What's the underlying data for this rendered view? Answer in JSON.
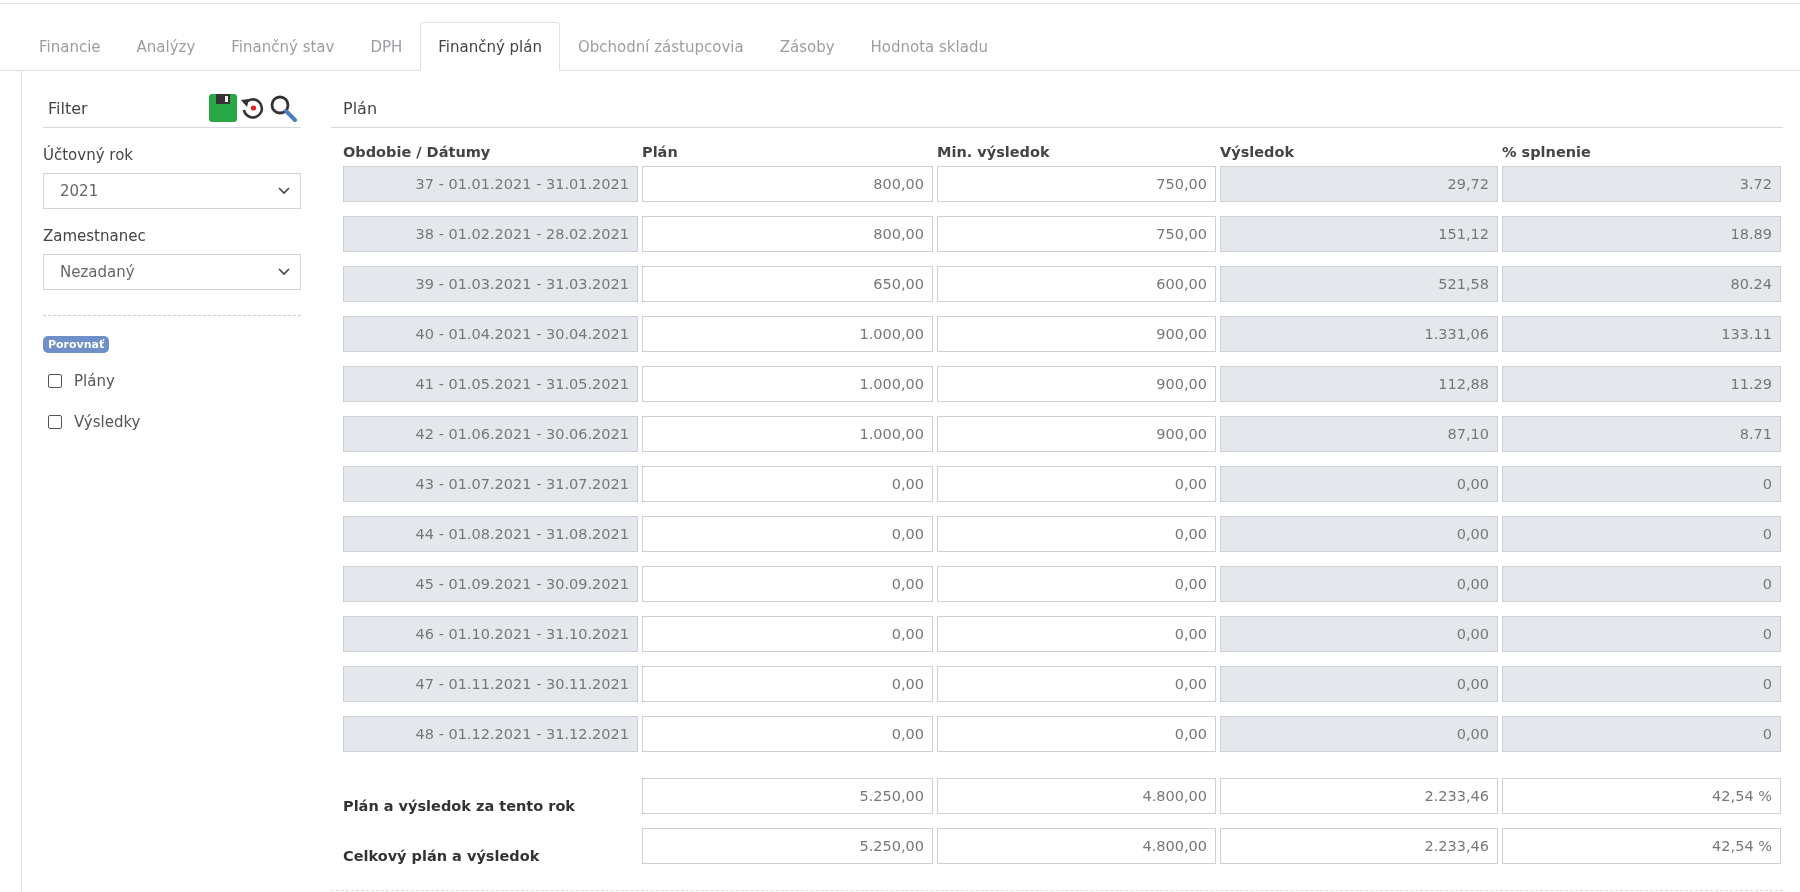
{
  "tabs": [
    {
      "label": "Financie",
      "selected": false
    },
    {
      "label": "Analýzy",
      "selected": false
    },
    {
      "label": "Finančný stav",
      "selected": false
    },
    {
      "label": "DPH",
      "selected": false
    },
    {
      "label": "Finančný plán",
      "selected": true
    },
    {
      "label": "Obchodní zástupcovia",
      "selected": false
    },
    {
      "label": "Zásoby",
      "selected": false
    },
    {
      "label": "Hodnota skladu",
      "selected": false
    }
  ],
  "filter": {
    "title": "Filter",
    "fields": [
      {
        "label": "Účtovný rok",
        "value": "2021"
      },
      {
        "label": "Zamestnanec",
        "value": "Nezadaný"
      }
    ],
    "compare_badge": "Porovnať",
    "checkboxes": [
      {
        "label": "Plány",
        "checked": false
      },
      {
        "label": "Výsledky",
        "checked": false
      }
    ]
  },
  "plan": {
    "title": "Plán",
    "columns": [
      {
        "label": "Obdobie / Dátumy",
        "kind": "readonly"
      },
      {
        "label": "Plán",
        "kind": "input"
      },
      {
        "label": "Min. výsledok",
        "kind": "input"
      },
      {
        "label": "Výsledok",
        "kind": "readonly"
      },
      {
        "label": "% splnenie",
        "kind": "readonly"
      }
    ],
    "rows": [
      [
        "37 - 01.01.2021 - 31.01.2021",
        "800,00",
        "750,00",
        "29,72",
        "3.72"
      ],
      [
        "38 - 01.02.2021 - 28.02.2021",
        "800,00",
        "750,00",
        "151,12",
        "18.89"
      ],
      [
        "39 - 01.03.2021 - 31.03.2021",
        "650,00",
        "600,00",
        "521,58",
        "80.24"
      ],
      [
        "40 - 01.04.2021 - 30.04.2021",
        "1.000,00",
        "900,00",
        "1.331,06",
        "133.11"
      ],
      [
        "41 - 01.05.2021 - 31.05.2021",
        "1.000,00",
        "900,00",
        "112,88",
        "11.29"
      ],
      [
        "42 - 01.06.2021 - 30.06.2021",
        "1.000,00",
        "900,00",
        "87,10",
        "8.71"
      ],
      [
        "43 - 01.07.2021 - 31.07.2021",
        "0,00",
        "0,00",
        "0,00",
        "0"
      ],
      [
        "44 - 01.08.2021 - 31.08.2021",
        "0,00",
        "0,00",
        "0,00",
        "0"
      ],
      [
        "45 - 01.09.2021 - 30.09.2021",
        "0,00",
        "0,00",
        "0,00",
        "0"
      ],
      [
        "46 - 01.10.2021 - 31.10.2021",
        "0,00",
        "0,00",
        "0,00",
        "0"
      ],
      [
        "47 - 01.11.2021 - 30.11.2021",
        "0,00",
        "0,00",
        "0,00",
        "0"
      ],
      [
        "48 - 01.12.2021 - 31.12.2021",
        "0,00",
        "0,00",
        "0,00",
        "0"
      ]
    ],
    "summary": [
      {
        "label": "Plán a výsledok za tento rok",
        "values": [
          "5.250,00",
          "4.800,00",
          "2.233,46",
          "42,54 %"
        ]
      },
      {
        "label": "Celkový plán a výsledok",
        "values": [
          "5.250,00",
          "4.800,00",
          "2.233,46",
          "42,54 %"
        ]
      }
    ]
  }
}
